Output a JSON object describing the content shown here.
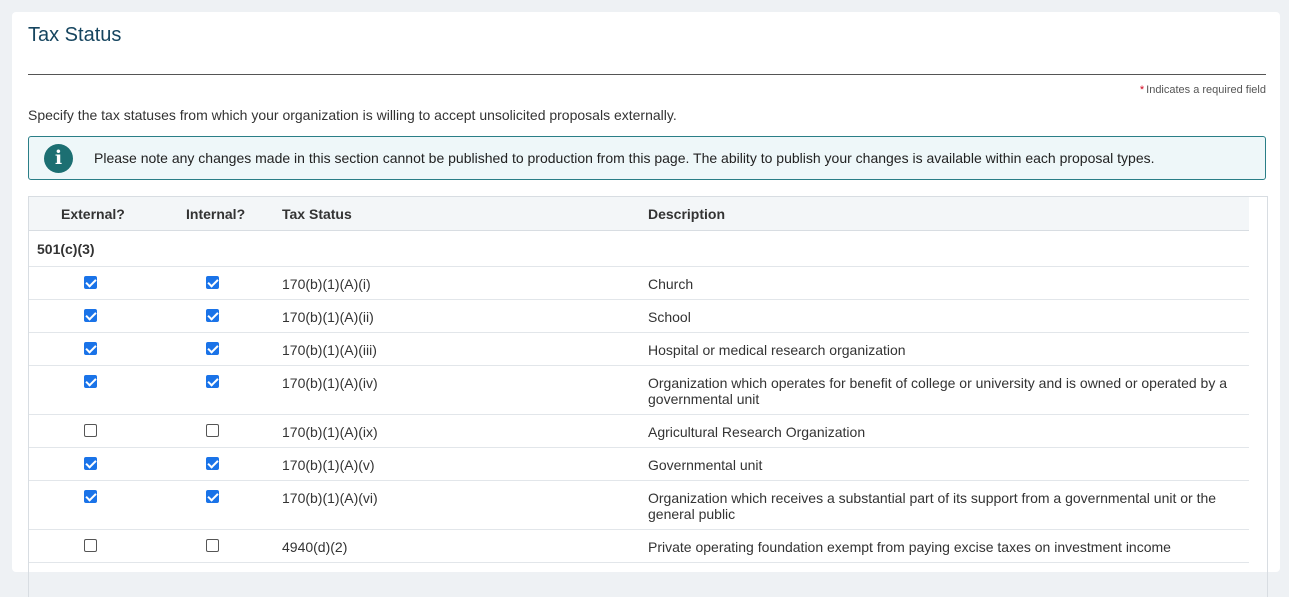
{
  "page": {
    "title": "Tax Status",
    "required_star": "*",
    "required_note": "Indicates a required field",
    "instructions": "Specify the tax statuses from which your organization is willing to accept unsolicited proposals externally."
  },
  "alert": {
    "icon": "info-icon",
    "text": "Please note any changes made in this section cannot be published to production from this page. The ability to publish your changes is available within each proposal types."
  },
  "table": {
    "headers": {
      "external": "External?",
      "internal": "Internal?",
      "tax_status": "Tax Status",
      "description": "Description"
    },
    "group": "501(c)(3)",
    "rows": [
      {
        "external": true,
        "internal": true,
        "status": "170(b)(1)(A)(i)",
        "description": "Church"
      },
      {
        "external": true,
        "internal": true,
        "status": "170(b)(1)(A)(ii)",
        "description": "School"
      },
      {
        "external": true,
        "internal": true,
        "status": "170(b)(1)(A)(iii)",
        "description": "Hospital or medical research organization"
      },
      {
        "external": true,
        "internal": true,
        "status": "170(b)(1)(A)(iv)",
        "description": "Organization which operates for benefit of college or university and is owned or operated by a governmental unit"
      },
      {
        "external": false,
        "internal": false,
        "status": "170(b)(1)(A)(ix)",
        "description": "Agricultural Research Organization"
      },
      {
        "external": true,
        "internal": true,
        "status": "170(b)(1)(A)(v)",
        "description": "Governmental unit"
      },
      {
        "external": true,
        "internal": true,
        "status": "170(b)(1)(A)(vi)",
        "description": "Organization which receives a substantial part of its support from a governmental unit or the general public"
      },
      {
        "external": false,
        "internal": false,
        "status": "4940(d)(2)",
        "description": "Private operating foundation exempt from paying excise taxes on investment income"
      }
    ]
  },
  "colors": {
    "title": "#16455f",
    "checkbox_checked": "#1a73e8",
    "alert_border": "#2a7e87",
    "alert_icon": "#1c6f72",
    "required_star": "#d0021b"
  }
}
